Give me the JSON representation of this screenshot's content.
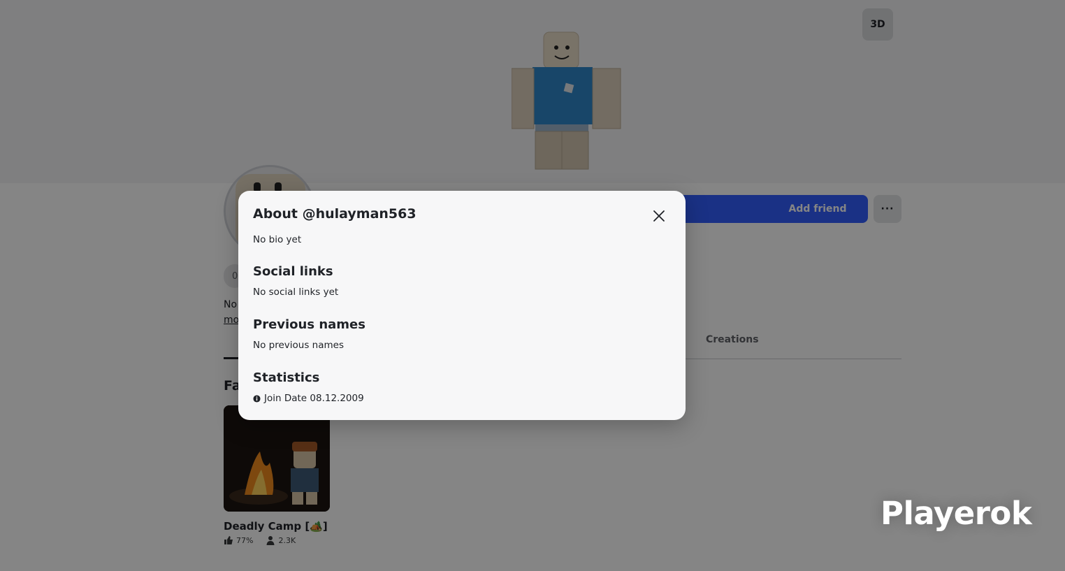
{
  "hero": {
    "view_toggle_label": "3D"
  },
  "profile": {
    "add_friend_label": "Add friend",
    "more_button_label": "···",
    "stat_chip_text": "0",
    "bio_stub": "No",
    "more_link": "mo",
    "tab_creations": "Creations",
    "favorites_heading_stub": "Fa"
  },
  "favorite_game": {
    "title": "Deadly Camp [🏕️]",
    "rating": "77%",
    "players": "2.3K"
  },
  "watermark": "Playerok",
  "modal": {
    "title": "About @hulayman563",
    "bio": "No bio yet",
    "social_heading": "Social links",
    "social_text": "No social links yet",
    "prev_heading": "Previous names",
    "prev_text": "No previous names",
    "stats_heading": "Statistics",
    "join_date": "Join Date 08.12.2009"
  },
  "colors": {
    "primary_button": "#335fff",
    "modal_bg": "#f7f7f8",
    "overlay": "rgba(0,0,0,0.48)"
  },
  "icons": [
    "close-icon",
    "info-icon",
    "thumbs-up-icon",
    "person-icon",
    "ellipsis-icon"
  ]
}
